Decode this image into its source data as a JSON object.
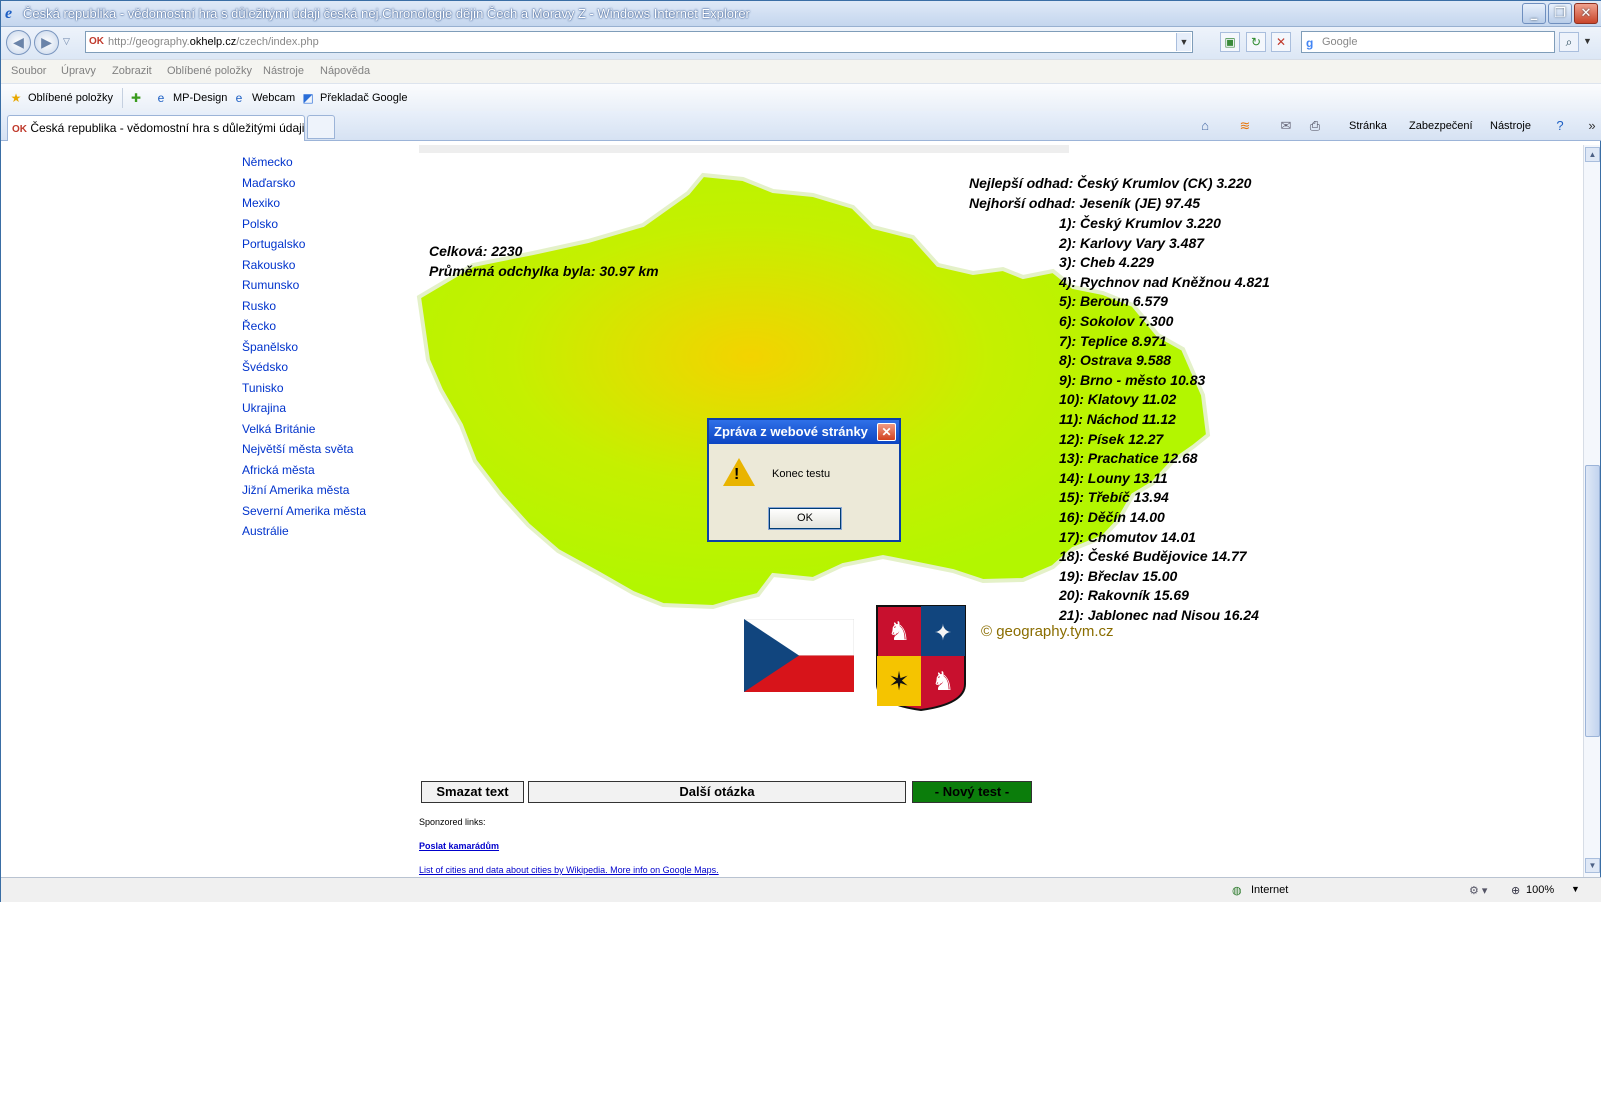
{
  "window": {
    "title": "Česká republika - vědomostní hra s důležitými údaji česká nej.Chronologie dějin Čech a Moravy Z - Windows Internet Explorer"
  },
  "address": {
    "favicon": "OK",
    "url_prefix": "http://geography.",
    "url_domain": "okhelp.cz",
    "url_path": "/czech/index.php"
  },
  "search": {
    "placeholder": "Google"
  },
  "menu": [
    "Soubor",
    "Úpravy",
    "Zobrazit",
    "Oblíbené položky",
    "Nástroje",
    "Nápověda"
  ],
  "favorites": {
    "label": "Oblíbené položky",
    "items": [
      "MP-Design",
      "Webcam",
      "Překladač Google"
    ]
  },
  "tab": {
    "favicon": "OK",
    "label": "Česká republika - vědomostní hra s důležitými údaji če..."
  },
  "commandbar": {
    "page": "Stránka",
    "security": "Zabezpečení",
    "tools": "Nástroje"
  },
  "sidebar": {
    "links": [
      "Německo",
      "Maďarsko",
      "Mexiko",
      "Polsko",
      "Portugalsko",
      "Rakousko",
      "Rumunsko",
      "Rusko",
      "Řecko",
      "Španělsko",
      "Švédsko",
      "Tunisko",
      "Ukrajina",
      "Velká Británie",
      "Největší města světa",
      "Africká města",
      "Jižní Amerika města",
      "Severní Amerika města",
      "Austrálie"
    ]
  },
  "score": {
    "total": "Celková: 2230",
    "avg": "Průměrná odchylka byla: 30.97 km"
  },
  "best": "Nejlepší odhad: Český Krumlov (CK) 3.220",
  "worst": "Nejhorší odhad: Jeseník (JE) 97.45",
  "results": [
    "1): Český Krumlov 3.220",
    "2): Karlovy Vary 3.487",
    "3): Cheb 4.229",
    "4): Rychnov nad Kněžnou 4.821",
    "5): Beroun 6.579",
    "6): Sokolov 7.300",
    "7): Teplice 8.971",
    "8): Ostrava 9.588",
    "9): Brno - město 10.83",
    "10): Klatovy 11.02",
    "11): Náchod 11.12",
    "12): Písek 12.27",
    "13): Prachatice 12.68",
    "14): Louny 13.11",
    "15): Třebíč 13.94",
    "16): Děčín 14.00",
    "17): Chomutov 14.01",
    "18): České Budějovice 14.77",
    "19): Břeclav 15.00",
    "20): Rakovník 15.69",
    "21): Jablonec nad Nisou 16.24"
  ],
  "copyright": "© geography.tym.cz",
  "buttons": {
    "clear": "Smazat text",
    "next": "Další otázka",
    "newtest": "- Nový test -"
  },
  "sponsored": "Sponzored links:",
  "links": {
    "share": "Poslat kamarádům",
    "wiki": "List of cities and data about cities by Wikipedia. More info on Google Maps."
  },
  "dialog": {
    "title": "Zpráva z webové stránky",
    "message": "Konec testu",
    "ok": "OK"
  },
  "status": {
    "zone": "Internet",
    "zoom": "100%"
  },
  "colors": {
    "map_center": "#f3d300",
    "map_edge": "#b3f600",
    "newtest_bg": "#0b7d0b",
    "link": "#0033cc"
  }
}
